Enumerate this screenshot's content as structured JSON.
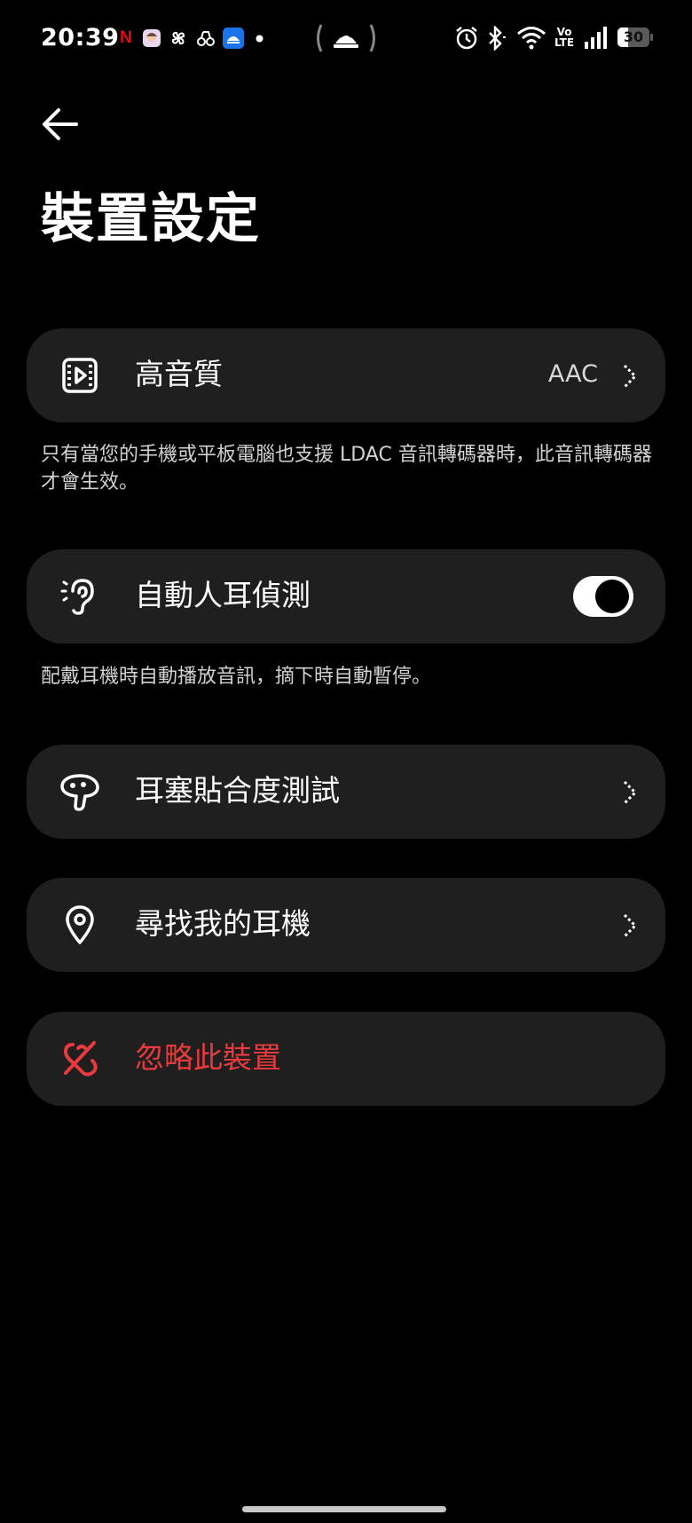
{
  "status_bar": {
    "time": "20:39",
    "netflix_glyph": "N",
    "volte_top": "Vo",
    "volte_bottom": "LTE",
    "battery_level": "30",
    "left_icons": [
      "netflix-icon",
      "avatar-app-icon",
      "pinwheel-icon",
      "link-icon",
      "cloud-app-icon",
      "dot-icon"
    ],
    "center_icon": "hotspot-icon",
    "right_icons": [
      "alarm-icon",
      "bluetooth-icon",
      "wifi-icon",
      "volte-icon",
      "signal-icon",
      "battery-icon"
    ]
  },
  "header": {
    "back_icon": "arrow-left-icon",
    "title": "裝置設定"
  },
  "settings": {
    "high_quality": {
      "icon": "audio-file-icon",
      "label": "高音質",
      "value": "AAC",
      "chevron_icon": "chevron-right-icon",
      "description": "只有當您的手機或平板電腦也支援 LDAC 音訊轉碼器時，此音訊轉碼器才會生效。"
    },
    "ear_detection": {
      "icon": "ear-icon",
      "label": "自動人耳偵測",
      "toggle_on": true,
      "description": "配戴耳機時自動播放音訊，摘下時自動暫停。"
    },
    "fit_test": {
      "icon": "earbud-icon",
      "label": "耳塞貼合度測試",
      "chevron_icon": "chevron-right-icon"
    },
    "find_earbuds": {
      "icon": "location-pin-icon",
      "label": "尋找我的耳機",
      "chevron_icon": "chevron-right-icon"
    },
    "forget_device": {
      "icon": "unlink-icon",
      "label": "忽略此裝置",
      "color": "#ea3a3e"
    }
  },
  "colors": {
    "background": "#000000",
    "card": "#1f1f1f",
    "danger": "#ea3a3e"
  }
}
